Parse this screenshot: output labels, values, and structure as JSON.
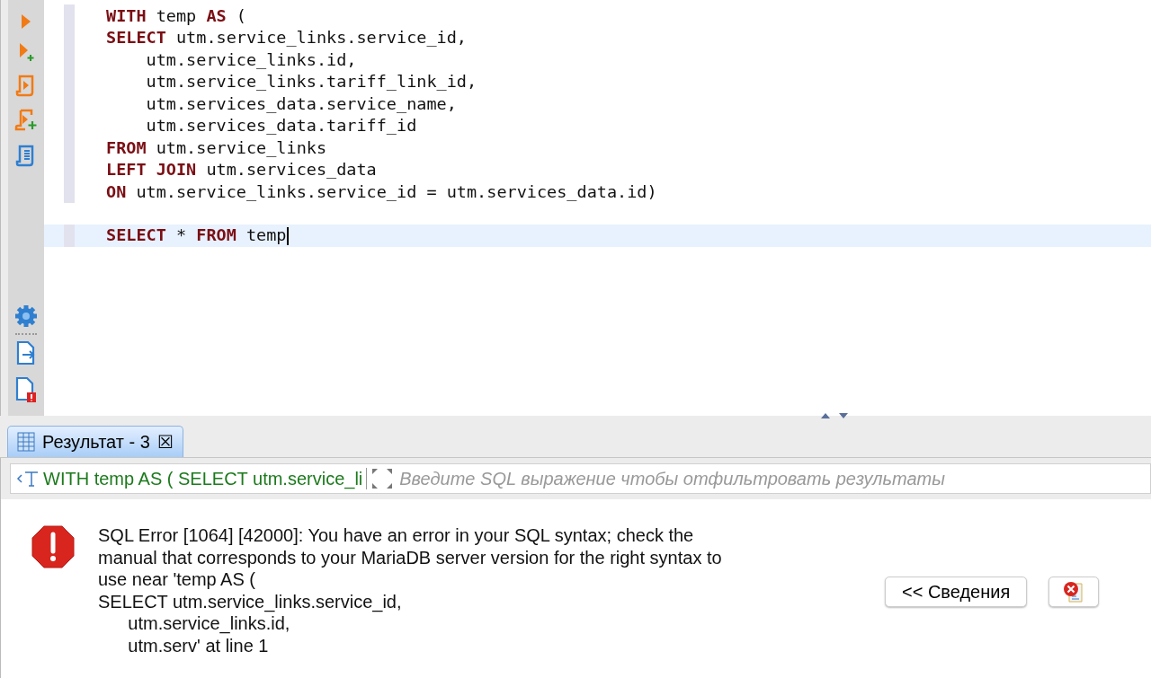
{
  "editor": {
    "lines": [
      {
        "current": false,
        "tokens": [
          {
            "kind": "keyword",
            "text": "WITH"
          },
          {
            "kind": "plain",
            "text": " temp "
          },
          {
            "kind": "keyword",
            "text": "AS"
          },
          {
            "kind": "plain",
            "text": " ("
          }
        ]
      },
      {
        "current": false,
        "tokens": [
          {
            "kind": "keyword",
            "text": "SELECT"
          },
          {
            "kind": "plain",
            "text": " utm.service_links.service_id,"
          }
        ]
      },
      {
        "current": false,
        "tokens": [
          {
            "kind": "plain",
            "text": "    utm.service_links.id,"
          }
        ]
      },
      {
        "current": false,
        "tokens": [
          {
            "kind": "plain",
            "text": "    utm.service_links.tariff_link_id,"
          }
        ]
      },
      {
        "current": false,
        "tokens": [
          {
            "kind": "plain",
            "text": "    utm.services_data.service_name,"
          }
        ]
      },
      {
        "current": false,
        "tokens": [
          {
            "kind": "plain",
            "text": "    utm.services_data.tariff_id"
          }
        ]
      },
      {
        "current": false,
        "tokens": [
          {
            "kind": "keyword",
            "text": "FROM"
          },
          {
            "kind": "plain",
            "text": " utm.service_links"
          }
        ]
      },
      {
        "current": false,
        "tokens": [
          {
            "kind": "keyword",
            "text": "LEFT JOIN"
          },
          {
            "kind": "plain",
            "text": " utm.services_data"
          }
        ]
      },
      {
        "current": false,
        "tokens": [
          {
            "kind": "keyword",
            "text": "ON"
          },
          {
            "kind": "plain",
            "text": " utm.service_links.service_id = utm.services_data.id)"
          }
        ]
      },
      {
        "current": false
      },
      {
        "current": true,
        "tokens": [
          {
            "kind": "keyword",
            "text": "SELECT"
          },
          {
            "kind": "plain",
            "text": " * "
          },
          {
            "kind": "keyword",
            "text": "FROM"
          },
          {
            "kind": "plain",
            "text": " temp"
          }
        ]
      }
    ]
  },
  "results_tab": {
    "label": "Результат - 3",
    "close": "☒"
  },
  "filter": {
    "query": "WITH temp AS ( SELECT utm.service_li",
    "placeholder": "Введите SQL выражение чтобы отфильтровать результаты"
  },
  "error": {
    "lines": [
      "SQL Error [1064] [42000]: You have an error in your SQL syntax; check the",
      "manual that corresponds to your MariaDB server version for the right syntax to",
      "use near 'temp AS (",
      "SELECT utm.service_links.service_id,",
      "      utm.service_links.id,",
      "      utm.serv' at line 1"
    ],
    "details_button": "<< Сведения"
  }
}
